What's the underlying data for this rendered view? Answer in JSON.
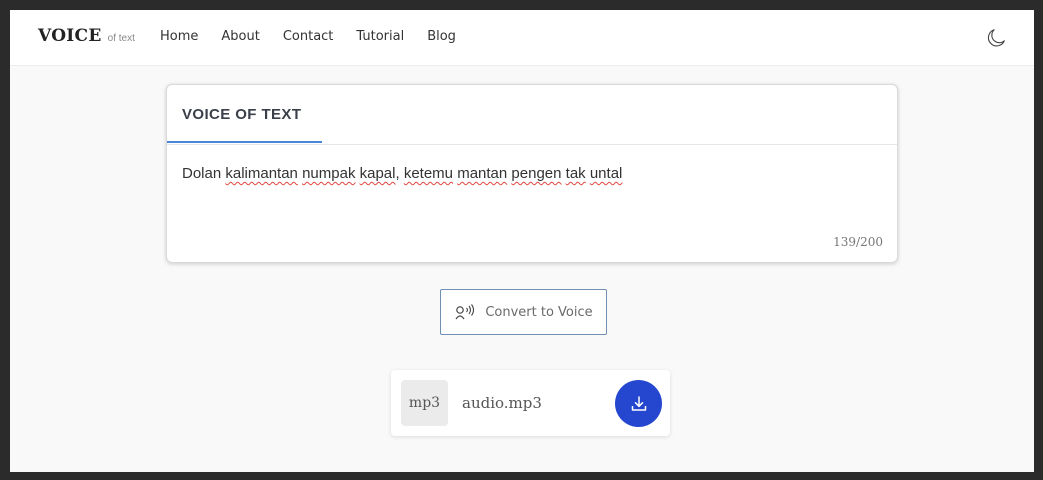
{
  "brand": {
    "name": "VOICE",
    "tagline": "of text"
  },
  "nav": {
    "items": [
      "Home",
      "About",
      "Contact",
      "Tutorial",
      "Blog"
    ],
    "theme_toggle_icon": "moon-icon"
  },
  "card": {
    "tab_label": "VOICE OF TEXT",
    "text_segments": [
      {
        "t": "Dolan ",
        "spell": false
      },
      {
        "t": "kalimantan",
        "spell": true
      },
      {
        "t": " ",
        "spell": false
      },
      {
        "t": "numpak",
        "spell": true
      },
      {
        "t": " ",
        "spell": false
      },
      {
        "t": "kapal",
        "spell": true
      },
      {
        "t": ", ",
        "spell": false
      },
      {
        "t": "ketemu",
        "spell": true
      },
      {
        "t": " ",
        "spell": false
      },
      {
        "t": "mantan",
        "spell": true
      },
      {
        "t": " ",
        "spell": false
      },
      {
        "t": "pengen",
        "spell": true
      },
      {
        "t": " ",
        "spell": false
      },
      {
        "t": "tak",
        "spell": true
      },
      {
        "t": " ",
        "spell": false
      },
      {
        "t": "untal",
        "spell": true
      }
    ],
    "char_count": "139/200"
  },
  "convert": {
    "label": "Convert to Voice",
    "icon": "voice-icon"
  },
  "audio": {
    "badge": "mp3",
    "filename": "audio.mp3",
    "download_icon": "download-icon"
  },
  "colors": {
    "accent": "#4a86d8",
    "download_bg": "#2547d0",
    "button_border": "#6f8fb5",
    "spell_underline": "#e0463c"
  }
}
